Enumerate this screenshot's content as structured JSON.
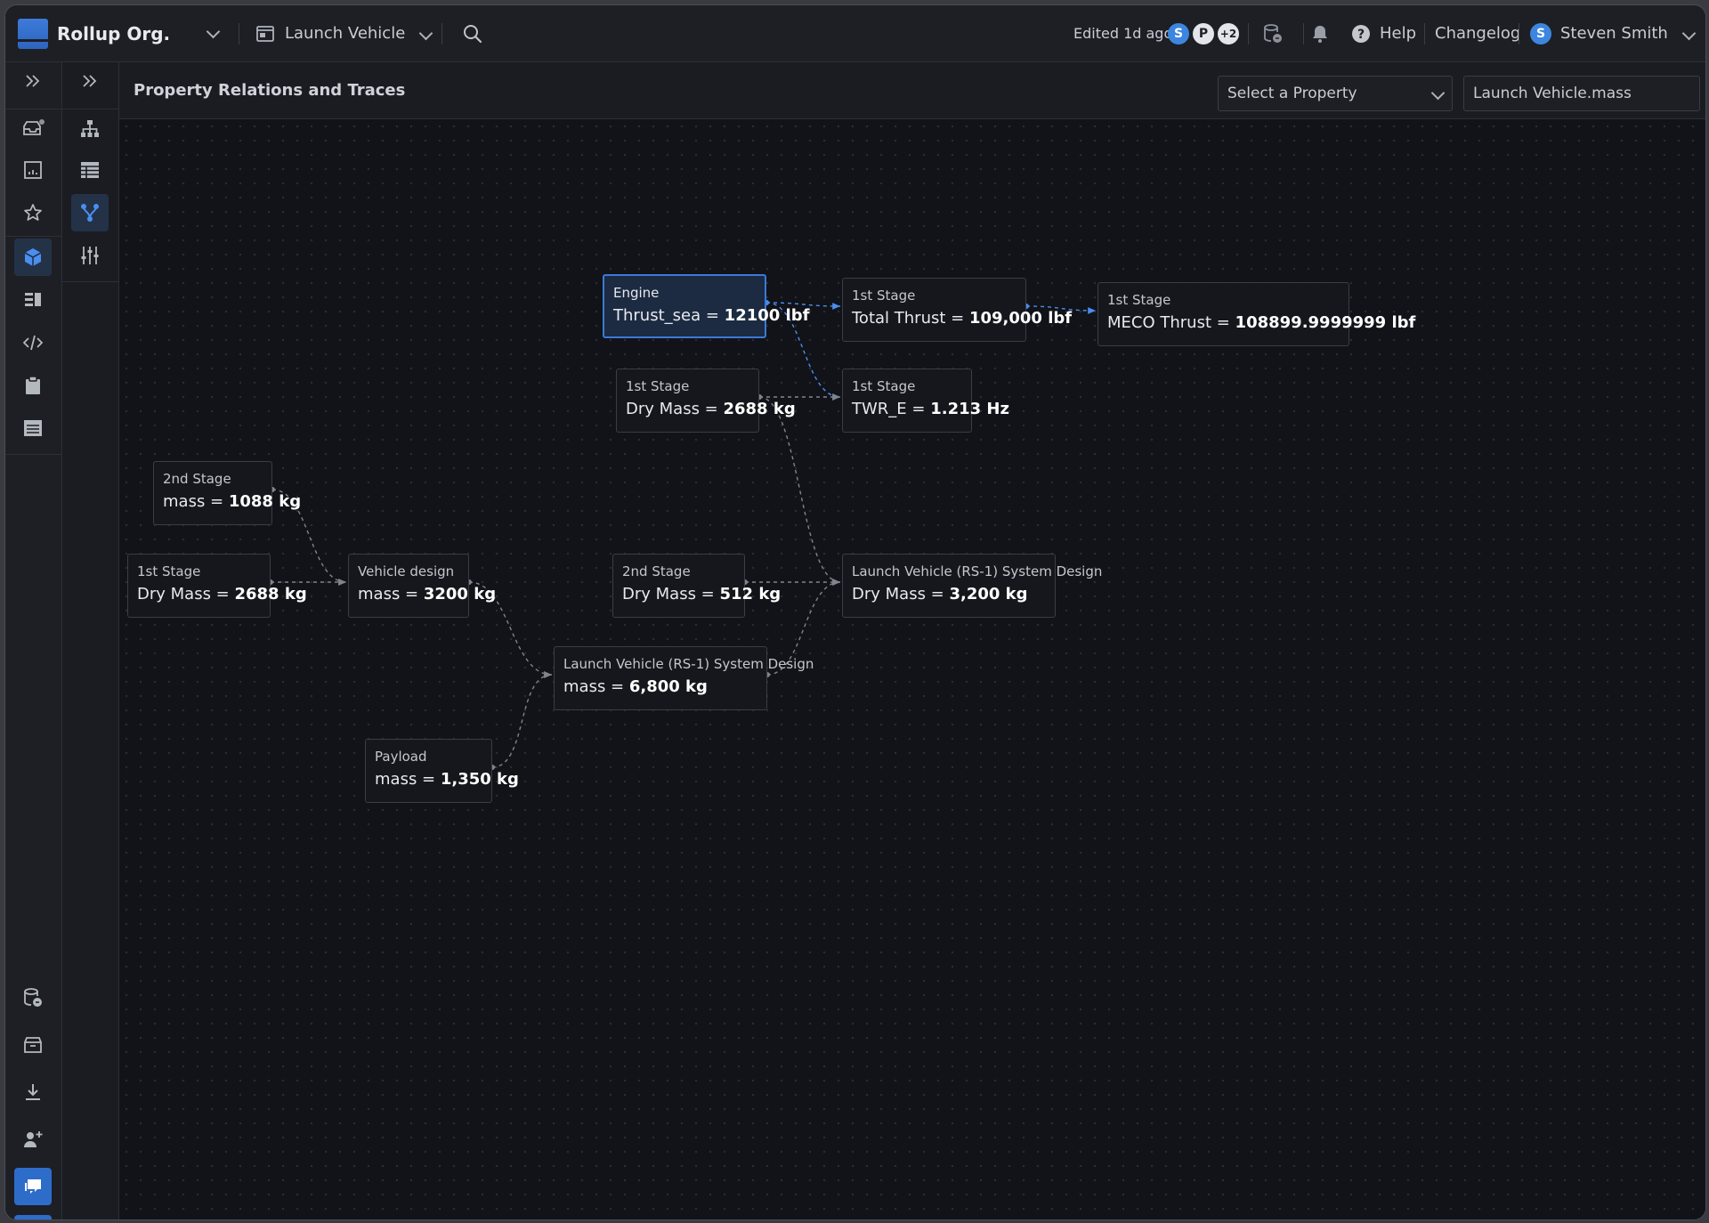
{
  "topbar": {
    "org_name": "Rollup Org.",
    "workspace": "Launch Vehicle",
    "edited": "Edited 1d ago",
    "collaborators": [
      {
        "initial": "S",
        "color": "#3c86e0"
      },
      {
        "initial": "P",
        "color": "#e3e5ea"
      },
      {
        "initial": "+2",
        "color": "#e3e5ea"
      }
    ],
    "help": "Help",
    "changelog": "Changelog",
    "user_initial": "S",
    "user_name": "Steven Smith"
  },
  "subheader": {
    "title": "Property Relations and Traces",
    "select_property": "Select a Property",
    "selected_property": "Launch Vehicle.mass"
  },
  "nodes": [
    {
      "id": "engine-thrust",
      "owner": "Engine",
      "name": "Thrust_sea",
      "value": "12100 lbf",
      "selected": true
    },
    {
      "id": "stage1-total-thrust",
      "owner": "1st Stage",
      "name": "Total Thrust",
      "value": "109,000 lbf"
    },
    {
      "id": "stage1-meco",
      "owner": "1st Stage",
      "name": "MECO Thrust",
      "value": "108899.9999999 lbf"
    },
    {
      "id": "stage1-drymass-a",
      "owner": "1st Stage",
      "name": "Dry Mass",
      "value": "2688 kg"
    },
    {
      "id": "stage1-twr",
      "owner": "1st Stage",
      "name": "TWR_E",
      "value": "1.213 Hz"
    },
    {
      "id": "stage2-mass",
      "owner": "2nd Stage",
      "name": "mass",
      "value": "1088 kg"
    },
    {
      "id": "stage1-drymass-b",
      "owner": "1st Stage",
      "name": "Dry Mass",
      "value": "2688 kg"
    },
    {
      "id": "vehicle-design-mass",
      "owner": "Vehicle design",
      "name": "mass",
      "value": "3200 kg"
    },
    {
      "id": "stage2-drymass",
      "owner": "2nd Stage",
      "name": "Dry Mass",
      "value": "512 kg"
    },
    {
      "id": "lv-drymass",
      "owner": "Launch Vehicle (RS-1) System Design",
      "name": "Dry Mass",
      "value": "3,200 kg"
    },
    {
      "id": "lv-mass",
      "owner": "Launch Vehicle (RS-1) System Design",
      "name": "mass",
      "value": "6,800 kg"
    },
    {
      "id": "payload-mass",
      "owner": "Payload",
      "name": "mass",
      "value": "1,350 kg"
    }
  ],
  "colors": {
    "accent": "#3c78d8",
    "edge_default": "#80848c",
    "edge_highlight": "#4a8ef0"
  }
}
